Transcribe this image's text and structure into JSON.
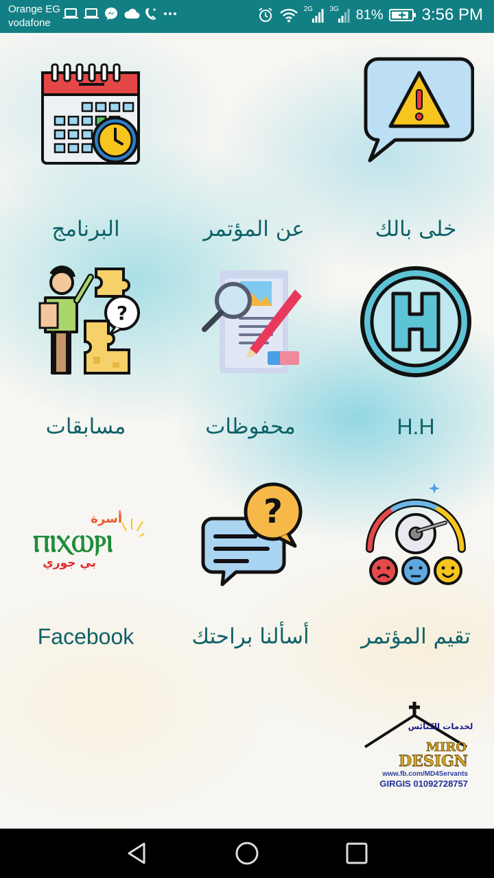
{
  "status_bar": {
    "carrier_1": "Orange EG",
    "carrier_2": "vodafone",
    "network_1": "2G",
    "network_2": "3G",
    "battery": "81%",
    "time": "3:56 PM",
    "left_icons": [
      "laptop-icon",
      "laptop-icon",
      "messenger-icon",
      "cloud-icon",
      "call-icon",
      "more-icon"
    ],
    "right_icons": [
      "alarm-icon",
      "wifi-icon",
      "signal-icon",
      "signal-icon",
      "battery-icon"
    ]
  },
  "tiles": [
    {
      "label": "خلى بالك",
      "icon": "warning-bubble-icon"
    },
    {
      "label": "عن المؤتمر",
      "icon": ""
    },
    {
      "label": "البرنامج",
      "icon": "calendar-clock-icon"
    },
    {
      "label": "H.H",
      "icon": "helipad-h-icon"
    },
    {
      "label": "محفوظات",
      "icon": "document-search-pencil-icon"
    },
    {
      "label": "مسابقات",
      "icon": "puzzle-teacher-icon"
    },
    {
      "label": "تقيم المؤتمر",
      "icon": "rating-gauge-icon"
    },
    {
      "label": "أسألنا براحتك",
      "icon": "question-chat-icon"
    },
    {
      "label": "Facebook",
      "icon": "family-logo-icon"
    }
  ],
  "facebook_logo": {
    "word_top": "أسرة",
    "coptic": "ⲠⲒⲬⲰⲢⲒ",
    "word_bottom": "بي جوري"
  },
  "credit": {
    "arabic": "لخدمات الكنائس",
    "brand_1": "MIRO",
    "brand_2": "DESIGN",
    "url": "www.fb.com/MD4Servants",
    "contact": "GIRGIS 01092728757"
  },
  "nav_bar": {
    "buttons": [
      "back",
      "home",
      "recents"
    ]
  },
  "colors": {
    "status_bar": "#127f84",
    "label_text": "#0f6168",
    "nav_bar": "#000000"
  }
}
